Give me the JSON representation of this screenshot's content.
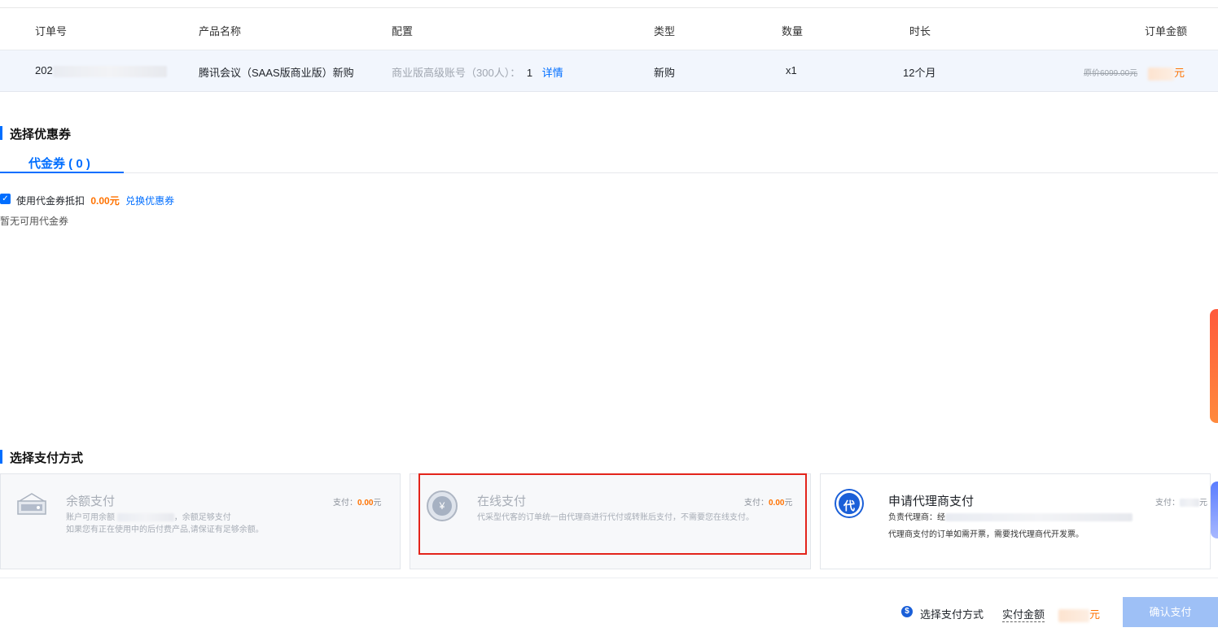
{
  "table": {
    "headers": [
      "订单号",
      "产品名称",
      "配置",
      "类型",
      "数量",
      "时长",
      "订单金额"
    ],
    "row": {
      "order_prefix": "202",
      "product": "腾讯会议（SAAS版商业版）新购",
      "config_text": "商业版高级账号（300人）：",
      "config_count": "1",
      "config_link": "详情",
      "type": "新购",
      "quantity": "x1",
      "duration": "12个月",
      "original_price": "原价6099.00元",
      "price_unit": "元"
    }
  },
  "coupon_section": {
    "title": "选择优惠券",
    "tab_label": "代金券 ( 0 )",
    "use_label": "使用代金券抵扣",
    "deduct_amount": "0.00元",
    "exchange_link": "兑换优惠券",
    "empty_text": "暂无可用代金券"
  },
  "payment_section": {
    "title": "选择支付方式",
    "cards": [
      {
        "title": "余额支付",
        "pay_label": "支付：",
        "pay_amount": "0.00",
        "pay_unit": "元",
        "desc_prefix": "账户可用余额",
        "desc_suffix": "，余额足够支付",
        "desc_line2": "如果您有正在使用中的后付费产品,请保证有足够余额。",
        "icon": "wallet-icon",
        "state": "disabled"
      },
      {
        "title": "在线支付",
        "pay_label": "支付：",
        "pay_amount": "0.00",
        "pay_unit": "元",
        "desc_line1": "代采型代客的订单统一由代理商进行代付或转账后支付，不需要您在线支付。",
        "icon": "yuan-icon",
        "state": "disabled"
      },
      {
        "title": "申请代理商支付",
        "pay_label": "支付：",
        "pay_unit": "元",
        "desc_prefix": "负责代理商：经",
        "desc_line2": "代理商支付的订单如需开票，需要找代理商代开发票。",
        "icon": "agent-icon",
        "icon_glyph": "代",
        "state": "enabled"
      }
    ]
  },
  "footer": {
    "tip_icon": "$",
    "tip": "选择支付方式",
    "amount_label": "实付金额",
    "amount_unit": "元",
    "confirm": "确认支付"
  },
  "colors": {
    "accent": "#006eff",
    "price": "#ff7200",
    "highlight_border": "#e3241b"
  }
}
